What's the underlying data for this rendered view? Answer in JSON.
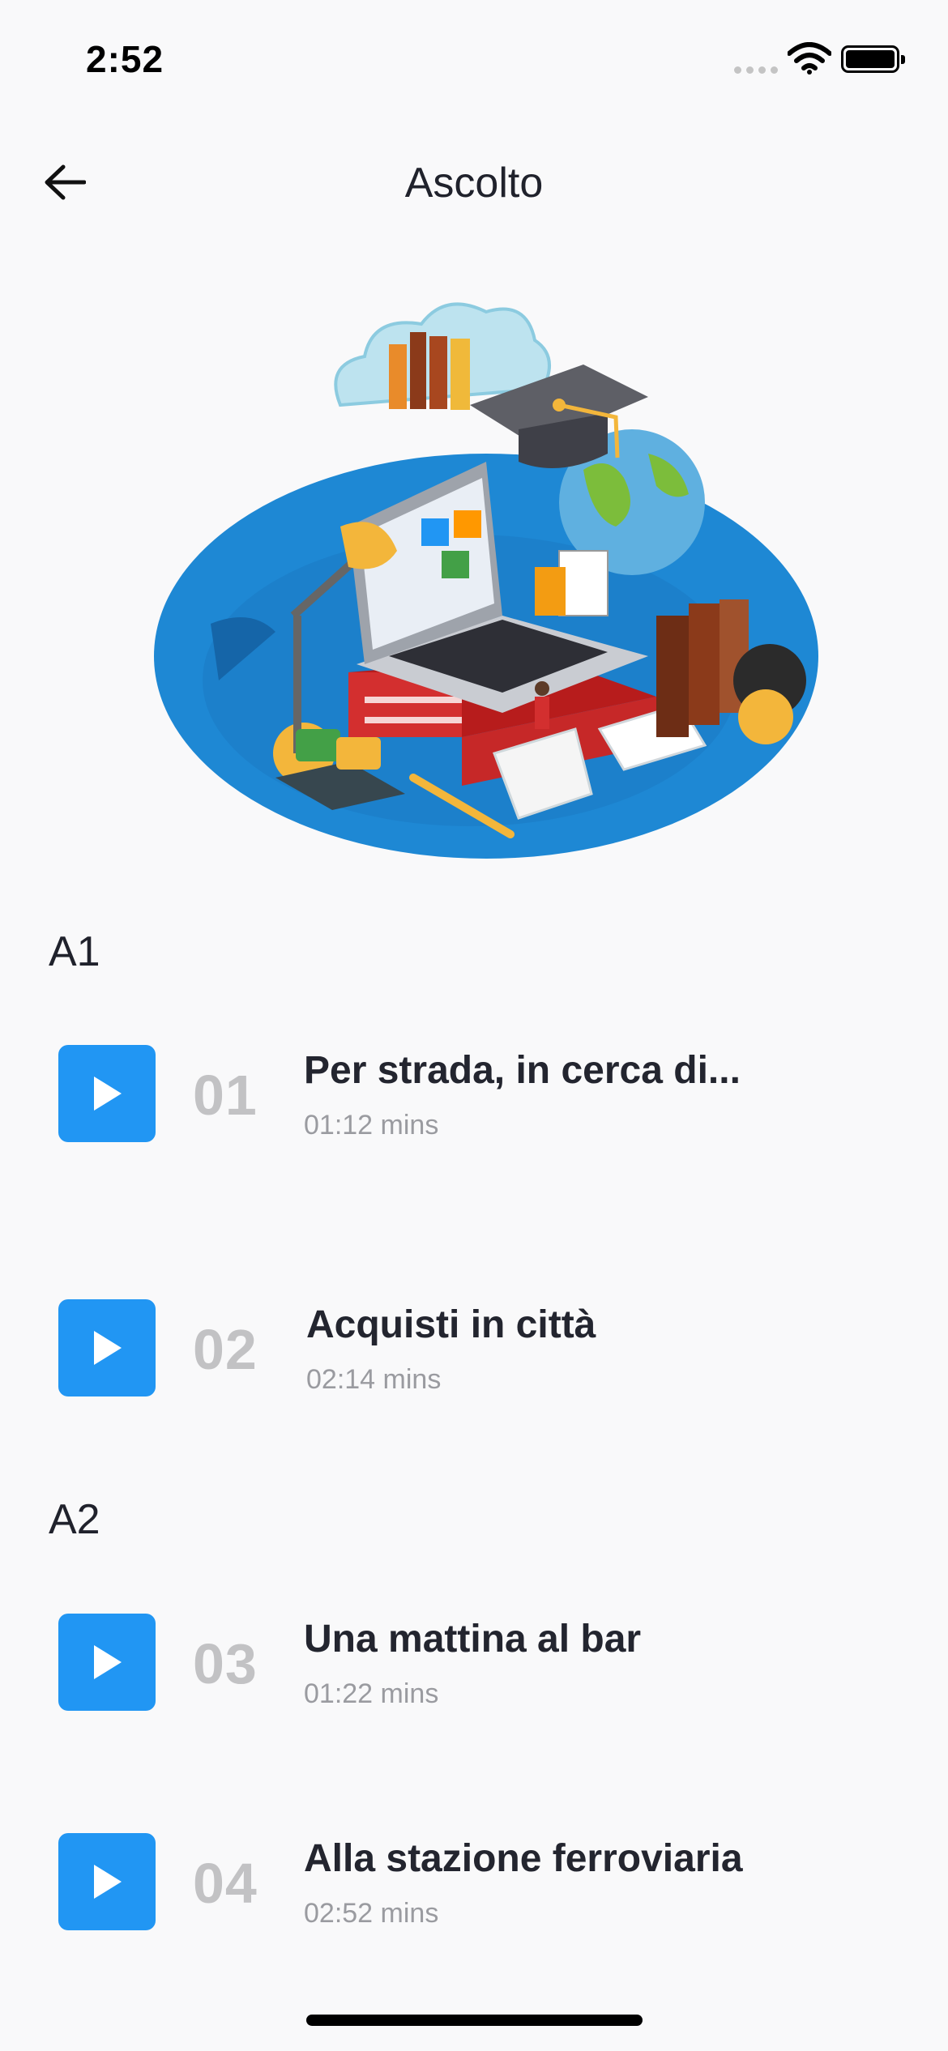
{
  "status_bar": {
    "time": "2:52"
  },
  "header": {
    "title": "Ascolto"
  },
  "sections": [
    {
      "label": "A1",
      "tracks": [
        {
          "number": "01",
          "title": "Per strada, in cerca di...",
          "duration": "01:12 mins"
        },
        {
          "number": "02",
          "title": "Acquisti in città",
          "duration": "02:14 mins"
        }
      ]
    },
    {
      "label": "A2",
      "tracks": [
        {
          "number": "03",
          "title": "Una mattina al bar",
          "duration": "01:22 mins"
        },
        {
          "number": "04",
          "title": "Alla stazione ferroviaria",
          "duration": "02:52 mins"
        }
      ]
    }
  ],
  "colors": {
    "accent": "#2196f3",
    "number": "#c2c2c4",
    "background": "#f9f9fa"
  },
  "icons": {
    "back": "arrow-left-icon",
    "play": "play-icon"
  }
}
